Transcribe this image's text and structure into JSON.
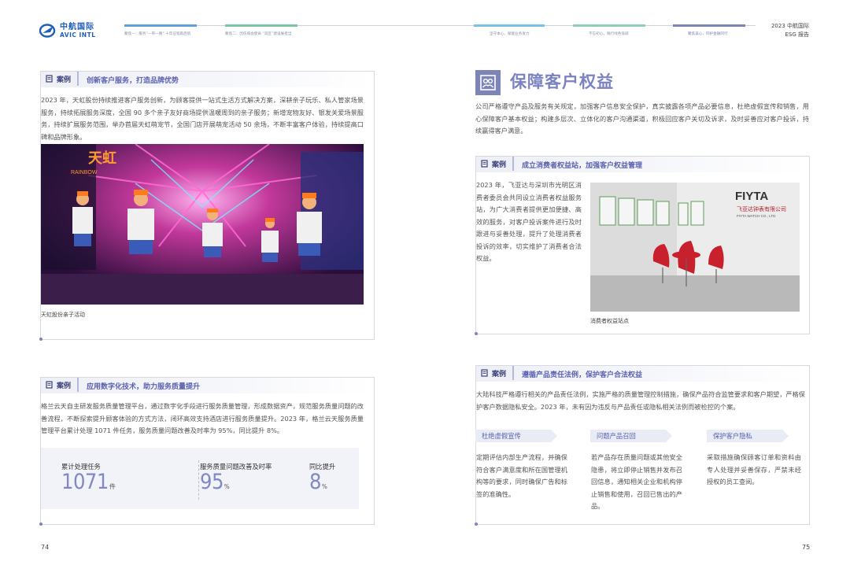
{
  "header": {
    "logo_cn": "中航国际",
    "logo_en": "AVIC INTL",
    "nav": [
      "聚焦一：服务“一带一路” 十年征程再启航",
      "聚焦二：因伤病会使命 “双区”建设展担当",
      "坚守本心，赋能业务发力",
      "不忘初心，践行绿色低碳",
      "聚焦美心，同护金融同行"
    ],
    "report_year": "2023 中航国际",
    "report_name": "ESG 报告",
    "colors": {
      "seg1": "#5f9fe0",
      "seg2": "#7bc6a0",
      "seg3": "#77c2e6",
      "seg4": "#8fd0b5",
      "seg5": "#7d84b8"
    }
  },
  "left": {
    "case1": {
      "badge": "案例",
      "title": "创新客户服务，打造品牌优势",
      "text": "2023 年，天虹股份持续推进客户服务创新，为顾客提供一站式生活方式解决方案，深耕亲子玩乐、私人管家场景服务，持续拓展服务深度，全国 90 多个亲子友好商场提供温暖周到的亲子服务；新增宠物友好、银发关爱场景服务，持续扩展服务范围，举办首届天虹萌宠节，全国门店开展萌宠活动 50 余场，不断丰富客户体验，持续提高口碑和品牌形象。",
      "photo_sign": "天虹",
      "photo_sign_en": "RAINBOW",
      "caption": "天虹股份亲子活动"
    },
    "case2": {
      "badge": "案例",
      "title": "应用数字化技术，助力服务质量提升",
      "text": "格兰云天自主研发服务质量管理平台，通过数字化手段进行服务质量管理，形成数据资产，规范服务质量问题的改善流程，不断探索提升顾客体验的方式方法，闭环高效支持酒店进行服务质量提升。2023 年，格兰云天服务质量管理平台累计处理 1071 件任务，服务质量问题改善及时率为 95%，同比提升 8%。",
      "stats": [
        {
          "label": "累计处理任务",
          "value": "1071",
          "unit": "件"
        },
        {
          "label": "服务质量问题改善及时率",
          "value": "95",
          "unit": "%"
        },
        {
          "label": "同比提升",
          "value": "8",
          "unit": "%"
        }
      ]
    },
    "page_number": "74"
  },
  "right": {
    "section_title": "保障客户权益",
    "intro": "公司严格遵守产品及服务有关规定，加强客户信息安全保护，真实披露各项产品必要信息，杜绝虚假宣传和销售，用心保障客户基本权益；构建多层次、立体化的客户沟通渠道，积极回应客户关切及诉求，及时妥善应对客户投诉，持续赢得客户满意。",
    "case3": {
      "badge": "案例",
      "title": "成立消费者权益站，加强客户权益管理",
      "text": "2023 年，飞亚达与深圳市光明区消费者委员会共同设立消费者权益服务站，为广大消费者提供更加便捷、高效的服务，对客户投诉案件进行及时跟进与妥善处理，提升了处理消费者投诉的效率，切实维护了消费者合法权益。",
      "photo_logo": "FIYTA",
      "photo_company": "飞亚达钟表有限公司",
      "photo_company_en": "FIYTA WATCH CO., LTD",
      "caption": "消费者权益站点"
    },
    "case4": {
      "badge": "案例",
      "title": "遵循产品责任法例，保护客户合法权益",
      "text": "大陆科技严格遵行相关的产品责任法例，实施严格的质量管理控制措施，确保产品符合监管要求和客户期望，严格保护客户数据隐私安全。2023 年，未有因为违反与产品责任或隐私相关法例而被检控的个案。",
      "columns": [
        {
          "tag": "杜绝虚假宣传",
          "text": "定期评估内部生产流程，并确保符合客户满意度和所在国管理机构等的要求，同时确保广告和标签的准确性。"
        },
        {
          "tag": "问题产品召回",
          "text": "若产品存在质量问题或其他安全隐患，将立即停止销售并发布召回信息，通知相关企业和机构停止销售和使用，召回已售出的产品。"
        },
        {
          "tag": "保护客户隐私",
          "text": "采取措施确保顾客订单和资料由专人处理并妥善保存，严禁未经授权的员工查阅。"
        }
      ]
    },
    "page_number": "75"
  }
}
